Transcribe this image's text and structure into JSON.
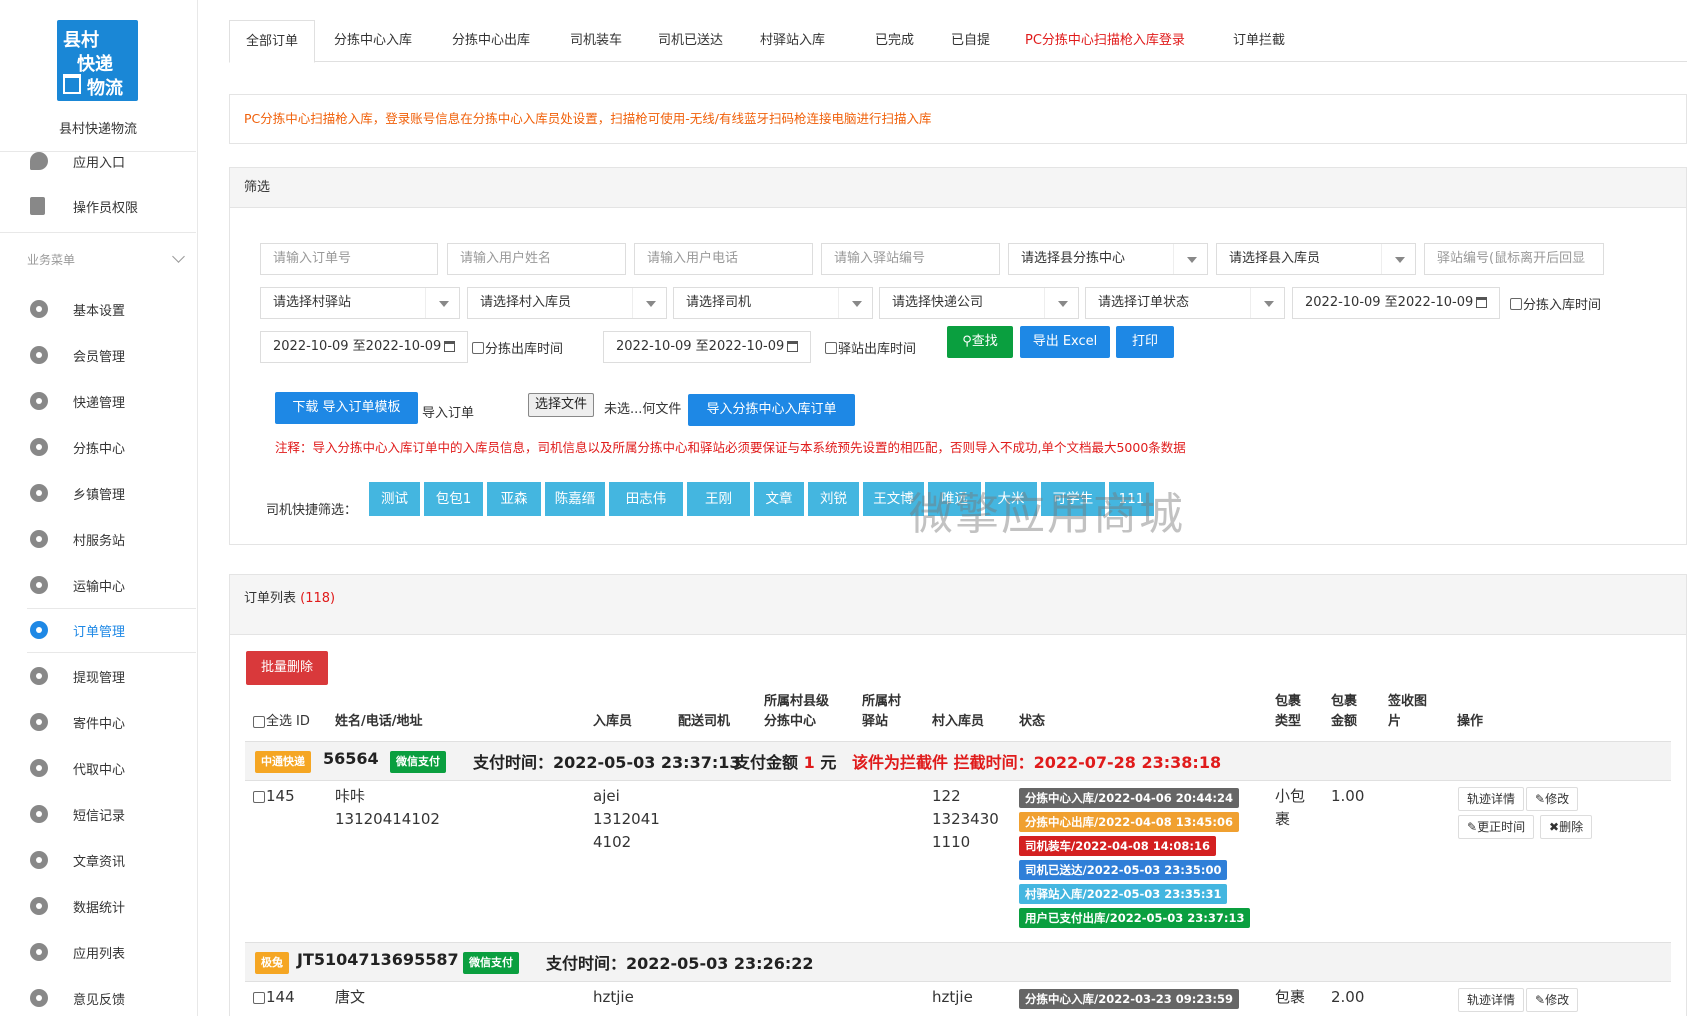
{
  "sidebar": {
    "logo_line1": "县村",
    "logo_line2": "快递",
    "logo_line3": "物流",
    "site_name": "县村快递物流",
    "top_items": [
      "应用入口",
      "操作员权限"
    ],
    "menu_header": "业务菜单",
    "items": [
      "基本设置",
      "会员管理",
      "快递管理",
      "分拣中心",
      "乡镇管理",
      "村服务站",
      "运输中心",
      "订单管理",
      "提现管理",
      "寄件中心",
      "代取中心",
      "短信记录",
      "文章资讯",
      "数据统计",
      "应用列表",
      "意见反馈"
    ],
    "active_item": "订单管理"
  },
  "tabs": [
    "全部订单",
    "分拣中心入库",
    "分拣中心出库",
    "司机装车",
    "司机已送达",
    "村驿站入库",
    "已完成",
    "已自提",
    "PC分拣中心扫描枪入库登录",
    "订单拦截"
  ],
  "notice": "PC分拣中心扫描枪入库，登录账号信息在分拣中心入库员处设置，扫描枪可使用-无线/有线蓝牙扫码枪连接电脑进行扫描入库",
  "filter": {
    "title": "筛选",
    "placeholders": [
      "请输入订单号",
      "请输入用户姓名",
      "请输入用户电话",
      "请输入驿站编号",
      "驿站编号(鼠标离开后回显"
    ],
    "selects_row1": [
      "请选择县分拣中心",
      "请选择县入库员"
    ],
    "selects_row2": [
      "请选择村驿站",
      "请选择村入库员",
      "请选择司机",
      "请选择快递公司",
      "请选择订单状态"
    ],
    "date_range": "2022-10-09 至2022-10-09",
    "chk_sort_in": "分拣入库时间",
    "chk_sort_out": "分拣出库时间",
    "chk_station_out": "驿站出库时间",
    "btn_search": "查找",
    "btn_export": "导出 Excel",
    "btn_print": "打印",
    "btn_download": "下载 导入订单模板",
    "import_label": "导入订单",
    "btn_choose": "选择文件",
    "no_file": "未选...何文件",
    "btn_import": "导入分拣中心入库订单",
    "warning": "注释：导入分拣中心入库订单中的入库员信息，司机信息以及所属分拣中心和驿站必须要保证与本系统预先设置的相匹配，否则导入不成功,单个文档最大5000条数据",
    "driver_label": "司机快捷筛选：",
    "drivers": [
      "测试",
      "包包1",
      "亚森",
      "陈嘉缙",
      "田志伟",
      "王刚",
      "文章",
      "刘锐",
      "王文博",
      "唯远",
      "大米",
      "可学生",
      "111"
    ]
  },
  "watermark": "微擎应用商城",
  "list": {
    "title": "订单列表",
    "count": "(118)",
    "btn_batch_delete": "批量删除",
    "headers": {
      "select_all": "全选",
      "id": "ID",
      "name": "姓名/电话/地址",
      "in_clerk": "入库员",
      "driver": "配送司机",
      "county_l1": "所属村县级",
      "county_l2": "分拣中心",
      "village_l1": "所属村",
      "village_l2": "驿站",
      "village_clerk": "村入库员",
      "status": "状态",
      "pkg_type_l1": "包裹",
      "pkg_type_l2": "类型",
      "pkg_amt_l1": "包裹",
      "pkg_amt_l2": "金额",
      "sign_l1": "签收图",
      "sign_l2": "片",
      "ops": "操作"
    },
    "orders": [
      {
        "company": "中通快递",
        "company_color": "#f5a623",
        "order_no": "56564",
        "pay_type": "微信支付",
        "pay_time": "支付时间：2022-05-03 23:37:13",
        "pay_amount_label": "支付金额",
        "pay_amount": "1",
        "pay_unit": "元",
        "intercept": "该件为拦截件 拦截时间：2022-07-28 23:38:18",
        "id": "145",
        "name": "咔咔",
        "phone": "13120414102",
        "clerk": [
          "ajei",
          "1312041",
          "4102"
        ],
        "village_clerk": [
          "122",
          "1323430",
          "1110"
        ],
        "statuses": [
          {
            "text": "分拣中心入库/2022-04-06 20:44:24",
            "color": "#666666"
          },
          {
            "text": "分拣中心出库/2022-04-08 13:45:06",
            "color": "#f0a030"
          },
          {
            "text": "司机装车/2022-04-08 14:08:16",
            "color": "#d42020"
          },
          {
            "text": "司机已送达/2022-05-03 23:35:00",
            "color": "#2f7fd8"
          },
          {
            "text": "村驿站入库/2022-05-03 23:35:31",
            "color": "#44b6e0"
          },
          {
            "text": "用户已支付出库/2022-05-03 23:37:13",
            "color": "#0a9f3f"
          }
        ],
        "pkg_type": [
          "小包",
          "裹"
        ],
        "pkg_amount": "1.00",
        "ops": [
          "轨迹详情",
          "修改",
          "更正时间",
          "删除"
        ]
      },
      {
        "company": "极兔",
        "company_color": "#f5a623",
        "order_no": "JT5104713695587",
        "pay_type": "微信支付",
        "pay_time": "支付时间：2022-05-03 23:26:22",
        "id": "144",
        "name": "唐文",
        "clerk": [
          "hztjie"
        ],
        "village_clerk": [
          "hztjie"
        ],
        "statuses": [
          {
            "text": "分拣中心入库/2022-03-23 09:23:59",
            "color": "#666666"
          }
        ],
        "pkg_type": [
          "包裹"
        ],
        "pkg_amount": "2.00",
        "ops": [
          "轨迹详情",
          "修改"
        ]
      }
    ]
  }
}
